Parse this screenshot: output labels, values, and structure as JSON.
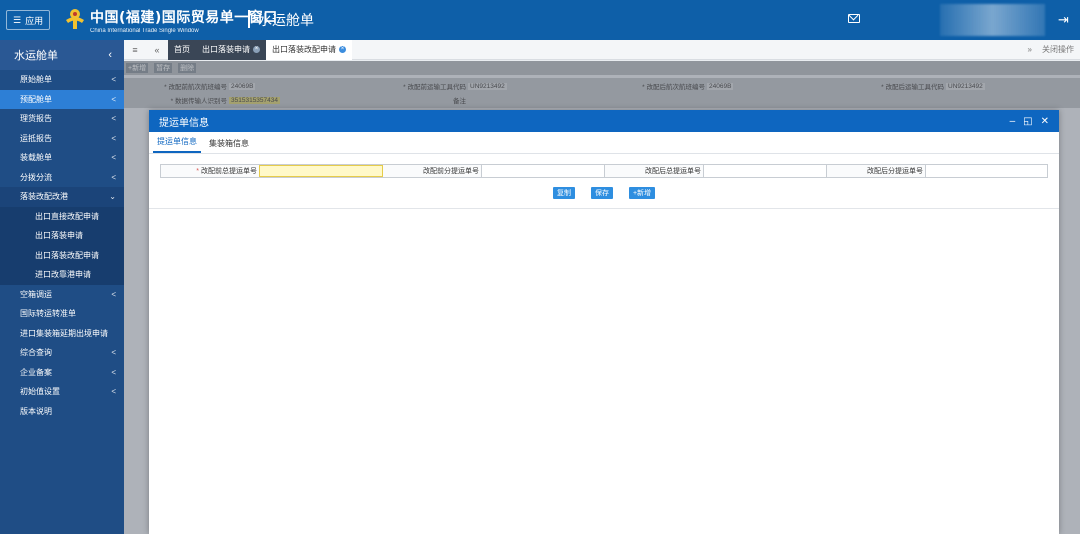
{
  "topbar": {
    "app_label": "应用",
    "brand_cn": "中国(福建)国际贸易单一窗口",
    "brand_en": "China International Trade Single Window",
    "page_title": "水运舱单"
  },
  "sidebar": {
    "title": "水运舱单",
    "items": [
      {
        "label": "原始舱单",
        "chevron": "<"
      },
      {
        "label": "预配舱单",
        "chevron": "<"
      },
      {
        "label": "理货报告",
        "chevron": "<"
      },
      {
        "label": "运抵报告",
        "chevron": "<"
      },
      {
        "label": "装载舱单",
        "chevron": "<"
      },
      {
        "label": "分拨分流",
        "chevron": "<"
      },
      {
        "label": "落装改配改港",
        "chevron": "⌄"
      }
    ],
    "sub_items": [
      {
        "label": "出口直接改配申请"
      },
      {
        "label": "出口落装申请"
      },
      {
        "label": "出口落装改配申请"
      },
      {
        "label": "进口改靠港申请"
      }
    ],
    "items_after": [
      {
        "label": "空箱调运",
        "chevron": "<"
      },
      {
        "label": "国际转运转准单",
        "chevron": ""
      },
      {
        "label": "进口集装箱延期出境申请",
        "chevron": ""
      },
      {
        "label": "综合查询",
        "chevron": "<"
      },
      {
        "label": "企业备案",
        "chevron": "<"
      },
      {
        "label": "初始值设置",
        "chevron": "<"
      },
      {
        "label": "版本说明",
        "chevron": ""
      }
    ]
  },
  "tabbar": {
    "home": "首页",
    "tabs": [
      {
        "label": "出口落装申请"
      },
      {
        "label": "出口落装改配申请"
      }
    ],
    "close_ops": "关闭操作"
  },
  "background": {
    "toolbar": [
      "+新增",
      "暂存",
      "删除"
    ],
    "row1": [
      {
        "label": "* 改配前航次航班编号",
        "value": "24069B"
      },
      {
        "label": "* 改配前运输工具代码",
        "value": "UN9213492"
      },
      {
        "label": "* 改配后航次航班编号",
        "value": "24069B"
      },
      {
        "label": "* 改配后运输工具代码",
        "value": "UN9213492"
      }
    ],
    "row2": [
      {
        "label": "* 数据传输人识别号",
        "value": "3515315357434"
      },
      {
        "label": "备注",
        "value": ""
      }
    ]
  },
  "modal": {
    "title": "提运单信息",
    "tabs": [
      {
        "label": "提运单信息"
      },
      {
        "label": "集装箱信息"
      }
    ],
    "fields": [
      {
        "label": "改配前总提运单号",
        "required": true,
        "value": ""
      },
      {
        "label": "改配前分提运单号",
        "required": false,
        "value": ""
      },
      {
        "label": "改配后总提运单号",
        "required": false,
        "value": ""
      },
      {
        "label": "改配后分提运单号",
        "required": false,
        "value": ""
      }
    ],
    "buttons": [
      {
        "label": "复制"
      },
      {
        "label": "保存"
      },
      {
        "label": "+新增"
      }
    ]
  },
  "colors": {
    "topbar": "#0e5fa8",
    "sidebar": "#1f4d85",
    "active_item": "#2d7fd6",
    "modal_header": "#0e66c0",
    "button": "#2e8ee0"
  }
}
